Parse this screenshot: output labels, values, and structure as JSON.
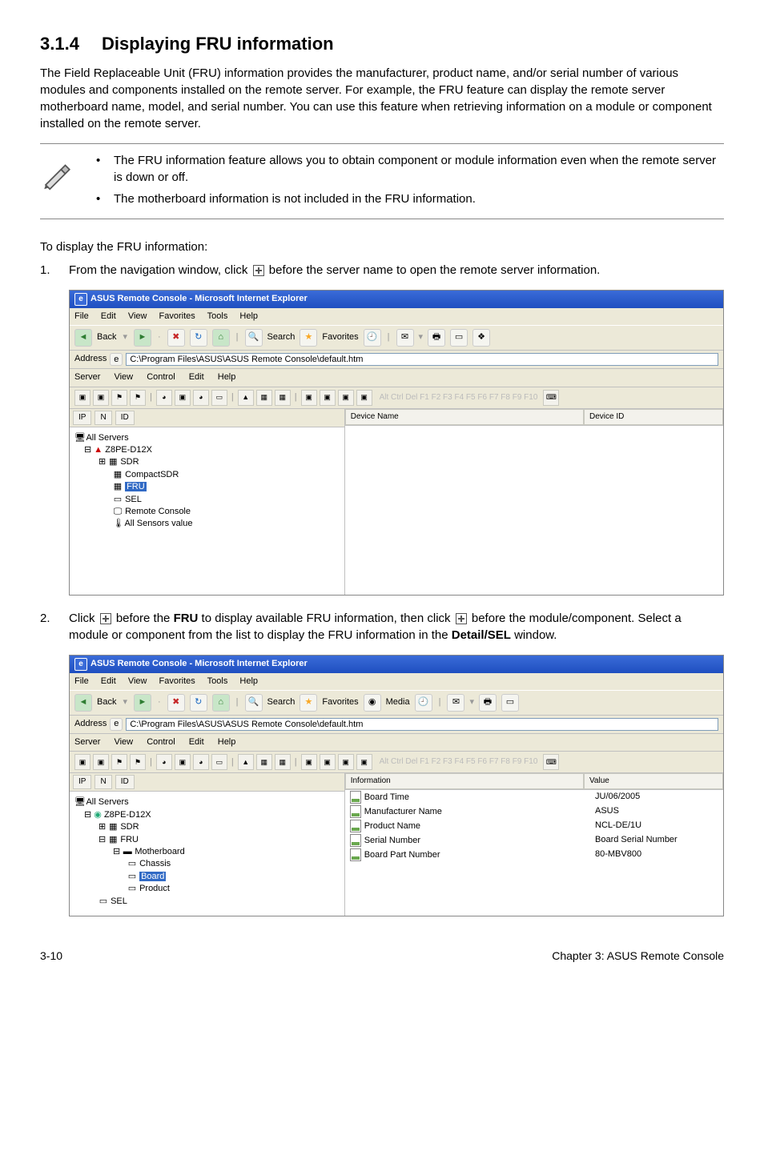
{
  "heading": {
    "number": "3.1.4",
    "title": "Displaying FRU information"
  },
  "intro": "The Field Replaceable Unit (FRU) information provides the manufacturer, product name, and/or serial number of various modules and components installed on the remote server. For example, the FRU feature can display the remote server motherboard name, model, and serial number. You can use this feature when retrieving information on a module or component installed on the remote server.",
  "notes": [
    "The FRU information feature allows you to obtain component or module information even when the remote server is down or off.",
    "The motherboard information is not included in the FRU information."
  ],
  "steps_intro": "To display the FRU information:",
  "step1_pre": "From the navigation window, click ",
  "step1_post": " before the server name to open the remote server information.",
  "step2_pre": "Click ",
  "step2_mid1": " before the ",
  "step2_fru": "FRU",
  "step2_mid2": " to display available FRU information, then click ",
  "step2_post": " before the module/component. Select a module or component from the list to display the FRU information in the ",
  "step2_win": "Detail/SEL",
  "step2_end": " window.",
  "ie": {
    "title": "ASUS Remote Console - Microsoft Internet Explorer",
    "menu": [
      "File",
      "Edit",
      "View",
      "Favorites",
      "Tools",
      "Help"
    ],
    "back": "Back",
    "search": "Search",
    "favorites": "Favorites",
    "media": "Media",
    "address_label": "Address",
    "address_value": "C:\\Program Files\\ASUS\\ASUS Remote Console\\default.htm"
  },
  "arc": {
    "menu": [
      "Server",
      "View",
      "Control",
      "Edit",
      "Help"
    ],
    "fkeys": "Alt Ctrl Del  F1  F2  F3  F4  F5  F6  F7  F8  F9  F10"
  },
  "tree": {
    "cols": [
      "IP",
      "N",
      "ID"
    ],
    "root": "All Servers",
    "server": "Z8PE-D12X",
    "items": [
      "SDR",
      "CompactSDR",
      "FRU",
      "SEL",
      "Remote Console",
      "All Sensors value"
    ],
    "fru_children": {
      "motherboard": "Motherboard",
      "sub": [
        "Chassis",
        "Board",
        "Product"
      ]
    },
    "sel2": "SEL"
  },
  "list1": {
    "cols": [
      "Device Name",
      "Device ID"
    ]
  },
  "list2": {
    "cols": [
      "Information",
      "Value"
    ],
    "rows": [
      [
        "Board Time",
        "JU/06/2005"
      ],
      [
        "Manufacturer Name",
        "ASUS"
      ],
      [
        "Product Name",
        "NCL-DE/1U"
      ],
      [
        "Serial Number",
        "Board Serial Number"
      ],
      [
        "Board Part Number",
        "80-MBV800"
      ]
    ]
  },
  "footer": {
    "left": "3-10",
    "right": "Chapter 3: ASUS Remote Console"
  }
}
